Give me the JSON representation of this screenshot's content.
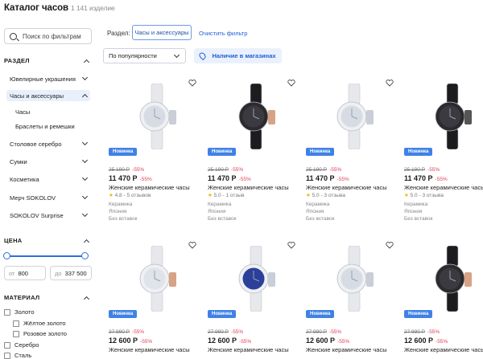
{
  "header": {
    "title": "Каталог часов",
    "count": "1 141 изделие"
  },
  "sidebar": {
    "search_placeholder": "Поиск по фильтрам",
    "section_title": "РАЗДЕЛ",
    "categories": [
      {
        "label": "Ювелирные украшения"
      },
      {
        "label": "Часы и аксессуары"
      },
      {
        "label": "Столовое серебро"
      },
      {
        "label": "Сумки"
      },
      {
        "label": "Косметика"
      },
      {
        "label": "Мерч SOKOLOV"
      },
      {
        "label": "SOKOLOV Surprise"
      }
    ],
    "subcategories": [
      "Часы",
      "Браслеты и ремешки"
    ],
    "price": {
      "title": "ЦЕНА",
      "from_prefix": "от",
      "from": "800",
      "to_prefix": "до",
      "to": "337 500"
    },
    "material": {
      "title": "МАТЕРИАЛ",
      "items": [
        "Золото",
        "Жёлтое золото",
        "Розовое золото",
        "Серебро",
        "Сталь"
      ]
    }
  },
  "filters": {
    "label": "Раздел:",
    "chip": "Часы и аксессуары",
    "clear": "Очистить фильтр",
    "sort": "По популярности",
    "stock_button": "Наличие в магазинах"
  },
  "products": [
    {
      "badge": "Новинка",
      "old_price": "25 190 Р",
      "discount": "-55%",
      "price": "11 470 Р",
      "name": "Женские керамические часы",
      "rating": "4.8 - 5 отзывов",
      "meta": [
        "Керамика",
        "Япония",
        "Без вставок"
      ],
      "color": "white"
    },
    {
      "badge": "Новинка",
      "old_price": "25 190 Р",
      "discount": "-55%",
      "price": "11 470 Р",
      "name": "Женские керамические часы",
      "rating": "5.0 - 1 отзыв",
      "meta": [
        "Керамика",
        "Япония",
        "Без вставок"
      ],
      "color": "black-rose"
    },
    {
      "badge": "Новинка",
      "old_price": "25 190 Р",
      "discount": "-55%",
      "price": "11 470 Р",
      "name": "Женские керамические часы",
      "rating": "5.0 - 3 отзыва",
      "meta": [
        "Керамика",
        "Япония",
        "Без вставок"
      ],
      "color": "white"
    },
    {
      "badge": "Новинка",
      "old_price": "25 190 Р",
      "discount": "-55%",
      "price": "11 470 Р",
      "name": "Женские керамические часы",
      "rating": "5.0 - 3 отзыва",
      "meta": [
        "Керамика",
        "Япония",
        "Без вставок"
      ],
      "color": "black"
    },
    {
      "badge": "Новинка",
      "old_price": "27 990 Р",
      "discount": "-55%",
      "price": "12 600 Р",
      "name": "Женские керамические часы",
      "color": "white-rose"
    },
    {
      "badge": "Новинка",
      "old_price": "27 990 Р",
      "discount": "-55%",
      "price": "12 600 Р",
      "name": "Женские керамические часы",
      "color": "white-blue"
    },
    {
      "badge": "Новинка",
      "old_price": "27 990 Р",
      "discount": "-55%",
      "price": "12 600 Р",
      "name": "Женские керамические часы",
      "color": "white"
    },
    {
      "badge": "Новинка",
      "old_price": "27 990 Р",
      "discount": "-55%",
      "price": "12 600 Р",
      "name": "Женские керамические часы",
      "color": "black-rose"
    }
  ]
}
